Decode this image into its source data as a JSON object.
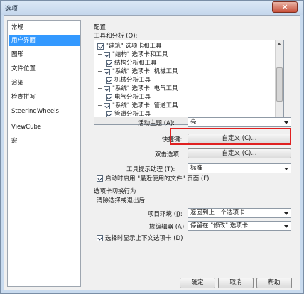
{
  "window": {
    "title": "选项",
    "close_label": "×"
  },
  "sidebar": {
    "items": [
      {
        "label": "常规",
        "selected": false
      },
      {
        "label": "用户界面",
        "selected": true
      },
      {
        "label": "图形",
        "selected": false
      },
      {
        "label": "文件位置",
        "selected": false
      },
      {
        "label": "渲染",
        "selected": false
      },
      {
        "label": "检查拼写",
        "selected": false
      },
      {
        "label": "SteeringWheels",
        "selected": false
      },
      {
        "label": "ViewCube",
        "selected": false
      },
      {
        "label": "宏",
        "selected": false
      }
    ]
  },
  "config": {
    "heading": "配置",
    "tools_label": "工具和分析 (O):",
    "tree": [
      {
        "text": "\"建筑\" 选项卡和工具",
        "level": 0,
        "checked": true,
        "expander": false
      },
      {
        "text": "\"结构\" 选项卡和工具",
        "level": 0,
        "checked": true,
        "expander": true
      },
      {
        "text": "结构分析和工具",
        "level": 1,
        "checked": true,
        "expander": false
      },
      {
        "text": "\"系统\" 选项卡: 机械工具",
        "level": 0,
        "checked": true,
        "expander": true
      },
      {
        "text": "机械分析工具",
        "level": 1,
        "checked": true,
        "expander": false
      },
      {
        "text": "\"系统\" 选项卡: 电气工具",
        "level": 0,
        "checked": true,
        "expander": true
      },
      {
        "text": "电气分析工具",
        "level": 1,
        "checked": true,
        "expander": false
      },
      {
        "text": "\"系统\" 选项卡: 管道工具",
        "level": 0,
        "checked": true,
        "expander": true
      },
      {
        "text": "管道分析工具",
        "level": 1,
        "checked": true,
        "expander": false
      }
    ],
    "theme_label": "活动主题 (A):",
    "theme_value": "亮",
    "shortcut_label": "快捷键:",
    "shortcut_button": "自定义 (C)...",
    "doubleclick_label": "双击选项:",
    "doubleclick_button": "自定义 (C)...",
    "tooltip_label": "工具提示助理 (T):",
    "tooltip_value": "标准",
    "recent_files_label": "启动时启用 \"最近使用的文件\" 页面 (F)",
    "recent_files_checked": true
  },
  "tab_switch": {
    "heading": "选项卡切换行为",
    "subheading": "清除选择或退出后:",
    "project_env_label": "项目环境 (J):",
    "project_env_value": "返回到上一个选项卡",
    "family_editor_label": "族编辑器 (A):",
    "family_editor_value": "停留在 \"修改\" 选项卡",
    "context_tab_label": "选择时显示上下文选项卡 (D)",
    "context_tab_checked": true
  },
  "footer": {
    "ok": "确定",
    "cancel": "取消",
    "help": "帮助"
  },
  "colors": {
    "selection": "#3399ff",
    "highlight_box": "#e02020"
  }
}
